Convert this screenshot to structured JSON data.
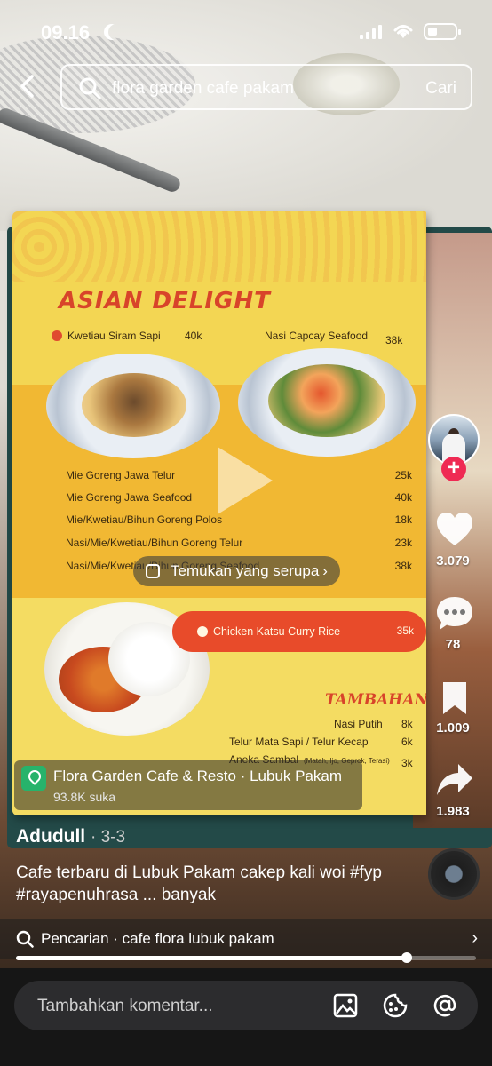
{
  "status_bar": {
    "time": "09.16"
  },
  "search": {
    "query": "flora garden cafe pakam",
    "submit_label": "Cari"
  },
  "menu": {
    "heading": "ASIAN DELIGHT",
    "featured": [
      {
        "name": "Kwetiau Siram Sapi",
        "price": "40k"
      },
      {
        "name": "Nasi Capcay Seafood",
        "price": "38k"
      }
    ],
    "items": [
      {
        "name": "Mie Goreng Jawa Telur",
        "price": "25k"
      },
      {
        "name": "Mie Goreng Jawa Seafood",
        "price": "40k"
      },
      {
        "name": "Mie/Kwetiau/Bihun Goreng Polos",
        "price": "18k"
      },
      {
        "name": "Nasi/Mie/Kwetiau/Bihun Goreng Telur",
        "price": "23k"
      },
      {
        "name": "Nasi/Mie/Kwetiau/Bihun Goreng Seafood",
        "price": "38k"
      }
    ],
    "special": {
      "name": "Chicken Katsu Curry Rice",
      "price": "35k"
    },
    "extras_heading": "TAMBAHAN",
    "extras": [
      {
        "name": "Nasi Putih",
        "price": "8k"
      },
      {
        "name": "Telur Mata Sapi / Telur Kecap",
        "price": "6k"
      },
      {
        "name": "Aneka Sambal",
        "note": "(Matah, Ijo, Geprek, Terasi)",
        "price": "3k"
      }
    ]
  },
  "overlay": {
    "find_similar": "Temukan yang serupa"
  },
  "actions": {
    "likes": "3.079",
    "comments": "78",
    "bookmarks": "1.009",
    "shares": "1.983"
  },
  "location": {
    "name": "Flora Garden Cafe & Resto · Lubuk Pakam",
    "likes": "93.8K suka"
  },
  "post": {
    "author": "Adudull",
    "date": "· 3-3",
    "caption": "Cafe terbaru di Lubuk Pakam cakep kali woi #fyp #rayapenuhrasa ... banyak"
  },
  "suggestion": {
    "text": "Pencarian · cafe flora lubuk pakam"
  },
  "playback": {
    "progress": 0.85
  },
  "comment": {
    "placeholder": "Tambahkan komentar..."
  },
  "colors": {
    "accent_red": "#ef2a53",
    "menu_yellow": "#f3d653",
    "menu_heading": "#d8442a"
  }
}
